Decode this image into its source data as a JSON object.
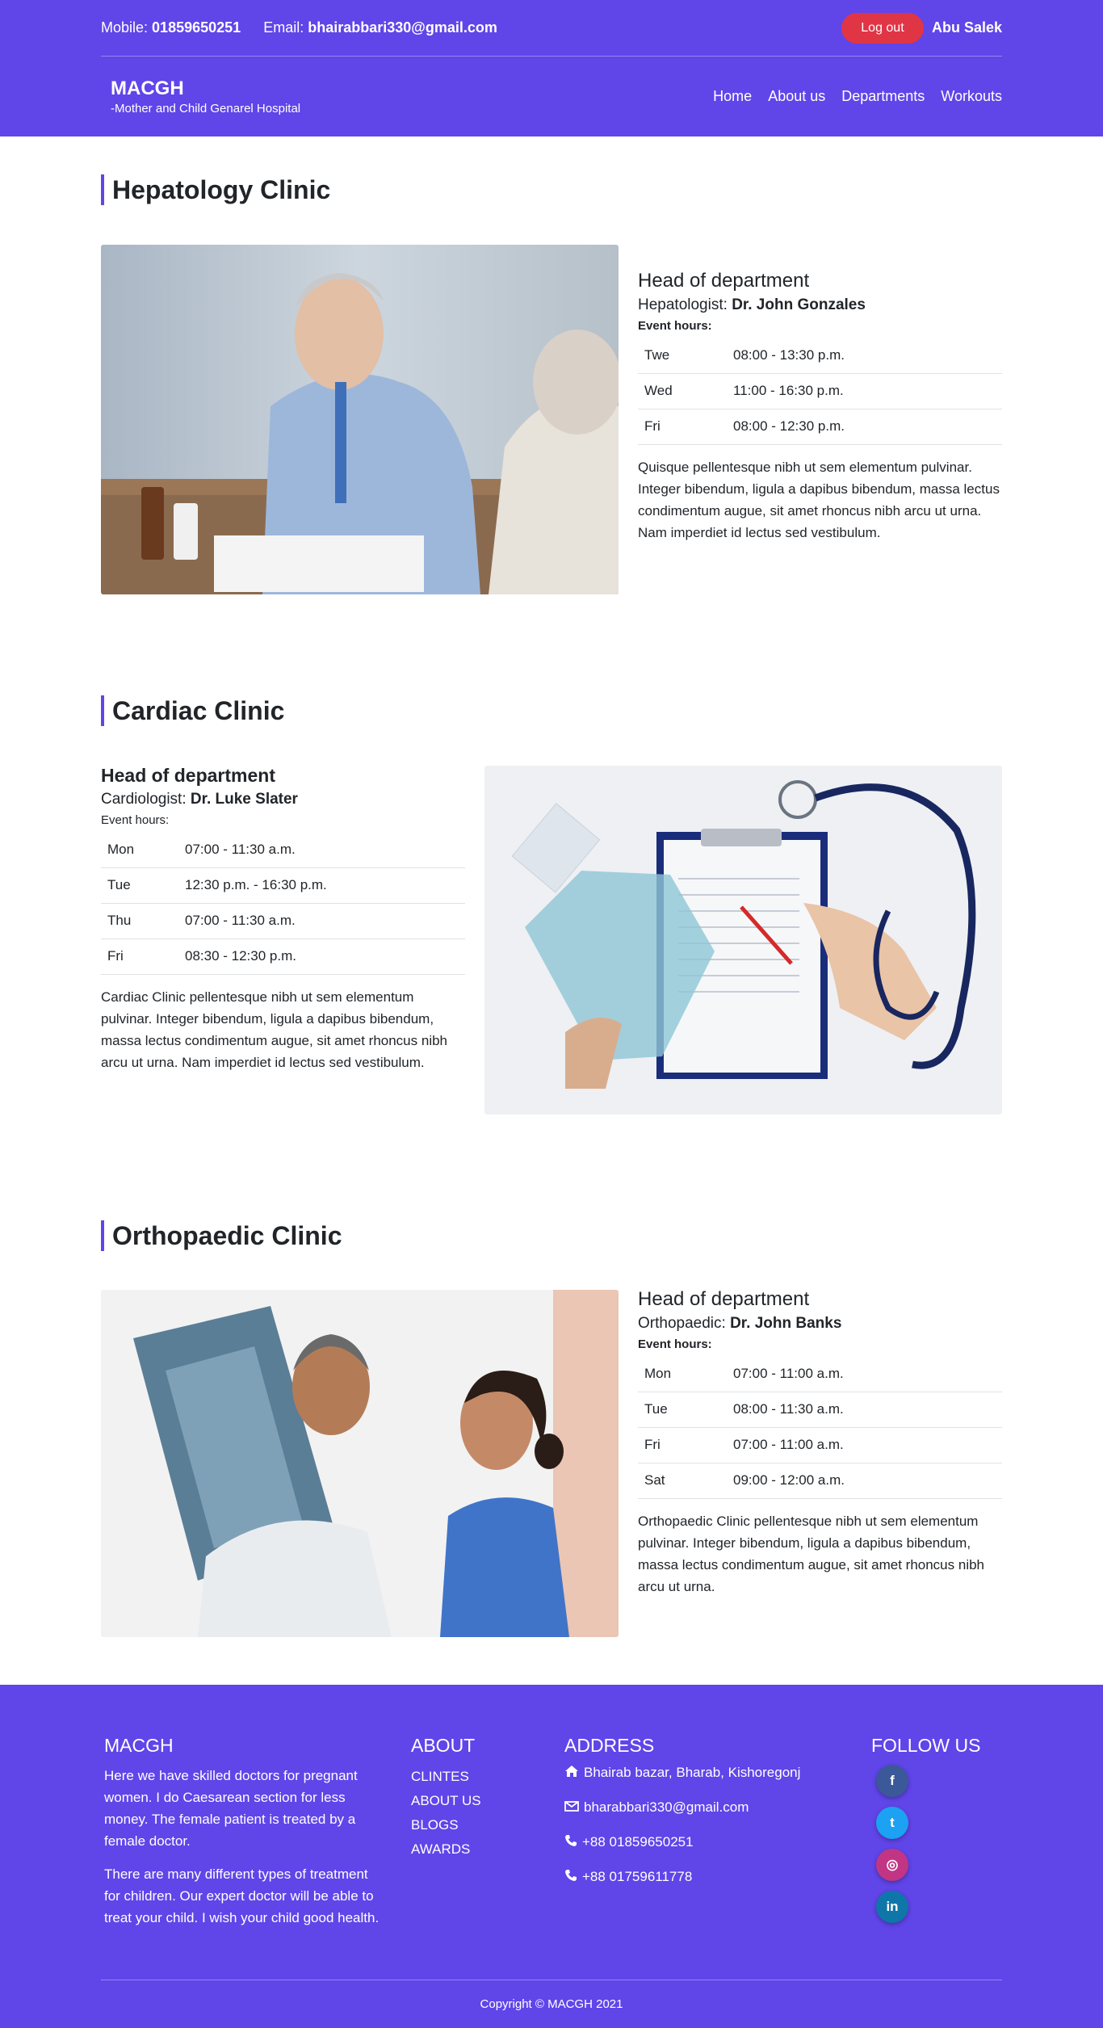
{
  "header": {
    "mobile_label": "Mobile:",
    "mobile": "01859650251",
    "email_label": "Email:",
    "email": "bhairabbari330@gmail.com",
    "logout_label": "Log out",
    "user_name": "Abu Salek",
    "brand_title": "MACGH",
    "brand_subtitle": "-Mother and Child Genarel Hospital",
    "nav": [
      "Home",
      "About us",
      "Departments",
      "Workouts"
    ]
  },
  "clinics": [
    {
      "title": "Hepatology Clinic",
      "head_label": "Head of department",
      "role": "Hepatologist:",
      "doctor": "Dr. John Gonzales",
      "hours_label": "Event hours:",
      "hours": [
        {
          "day": "Twe",
          "time": "08:00 - 13:30 p.m."
        },
        {
          "day": "Wed",
          "time": "11:00 - 16:30 p.m."
        },
        {
          "day": "Fri",
          "time": "08:00 - 12:30 p.m."
        }
      ],
      "description": "Quisque pellentesque nibh ut sem elementum pulvinar. Integer bibendum, ligula a dapibus bibendum, massa lectus condimentum augue, sit amet rhoncus nibh arcu ut urna. Nam imperdiet id lectus sed vestibulum."
    },
    {
      "title": "Cardiac Clinic",
      "head_label": "Head of department",
      "role": "Cardiologist:",
      "doctor": "Dr. Luke Slater",
      "hours_label": "Event hours:",
      "hours": [
        {
          "day": "Mon",
          "time": "07:00 - 11:30 a.m."
        },
        {
          "day": "Tue",
          "time": "12:30 p.m. - 16:30 p.m."
        },
        {
          "day": "Thu",
          "time": "07:00 - 11:30 a.m."
        },
        {
          "day": "Fri",
          "time": "08:30 - 12:30 p.m."
        }
      ],
      "description": "Cardiac Clinic pellentesque nibh ut sem elementum pulvinar. Integer bibendum, ligula a dapibus bibendum, massa lectus condimentum augue, sit amet rhoncus nibh arcu ut urna. Nam imperdiet id lectus sed vestibulum."
    },
    {
      "title": "Orthopaedic Clinic",
      "head_label": "Head of department",
      "role": "Orthopaedic:",
      "doctor": "Dr. John Banks",
      "hours_label": "Event hours:",
      "hours": [
        {
          "day": "Mon",
          "time": "07:00 - 11:00 a.m."
        },
        {
          "day": "Tue",
          "time": "08:00 - 11:30 a.m."
        },
        {
          "day": "Fri",
          "time": "07:00 - 11:00 a.m."
        },
        {
          "day": "Sat",
          "time": "09:00 - 12:00 a.m."
        }
      ],
      "description": "Orthopaedic Clinic pellentesque nibh ut sem elementum pulvinar. Integer bibendum, ligula a dapibus bibendum, massa lectus condimentum augue, sit amet rhoncus nibh arcu ut urna."
    }
  ],
  "footer": {
    "brand": "MACGH",
    "para1": "Here we have skilled doctors for pregnant women. I do Caesarean section for less money. The female patient is treated by a female doctor.",
    "para2": "There are many different types of treatment for children. Our expert doctor will be able to treat your child. I wish your child good health.",
    "about_title": "ABOUT",
    "about_links": [
      "CLINTES",
      "ABOUT US",
      "BLOGS",
      "AWARDS"
    ],
    "address_title": "ADDRESS",
    "address": "Bhairab bazar, Bharab, Kishoregonj",
    "email": "bharabbari330@gmail.com",
    "phone1": "+88 01859650251",
    "phone2": "+88 01759611778",
    "follow_title": "FOLLOW US",
    "social": [
      {
        "name": "facebook",
        "glyph": "f",
        "color": "#3b5998"
      },
      {
        "name": "twitter",
        "glyph": "t",
        "color": "#1da1f2"
      },
      {
        "name": "instagram",
        "glyph": "◎",
        "color": "#c13584"
      },
      {
        "name": "linkedin",
        "glyph": "in",
        "color": "#0e76a8"
      }
    ],
    "copyright": "Copyright © MACGH 2021"
  },
  "colors": {
    "primary": "#6045e9",
    "danger": "#e03545"
  }
}
